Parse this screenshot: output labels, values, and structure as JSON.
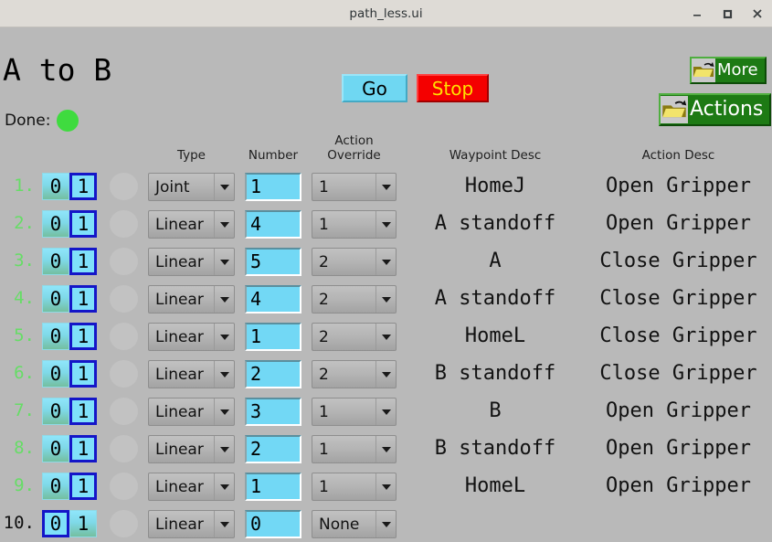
{
  "window": {
    "title": "path_less.ui",
    "controls": [
      {
        "name": "minimize-button",
        "glyph": "minimize"
      },
      {
        "name": "maximize-button",
        "glyph": "maximize"
      },
      {
        "name": "close-button",
        "glyph": "close"
      }
    ]
  },
  "header": {
    "app_title": "A to B",
    "done_label": "Done:",
    "done_color": "#3fdb3f",
    "go_label": "Go",
    "stop_label": "Stop",
    "more_label": "More",
    "actions_label": "Actions",
    "go_color": "#6fd7f2",
    "stop_color": "#f40000",
    "stop_text_color": "#ffe000",
    "folder_button_color": "#1d7a14"
  },
  "columns": {
    "type": "Type",
    "number": "Number",
    "action_override_line1": "Action",
    "action_override_line2": "Override",
    "waypoint_desc": "Waypoint Desc",
    "action_desc": "Action Desc"
  },
  "toggle": {
    "off_label": "0",
    "on_label": "1"
  },
  "rows": [
    {
      "index": "1.",
      "index_color": "green",
      "toggle_selected": "1",
      "type": "Joint",
      "number": "1",
      "override": "1",
      "waypoint": "HomeJ",
      "action": "Open Gripper"
    },
    {
      "index": "2.",
      "index_color": "green",
      "toggle_selected": "1",
      "type": "Linear",
      "number": "4",
      "override": "1",
      "waypoint": "A standoff",
      "action": "Open Gripper"
    },
    {
      "index": "3.",
      "index_color": "green",
      "toggle_selected": "1",
      "type": "Linear",
      "number": "5",
      "override": "2",
      "waypoint": "A",
      "action": "Close Gripper"
    },
    {
      "index": "4.",
      "index_color": "green",
      "toggle_selected": "1",
      "type": "Linear",
      "number": "4",
      "override": "2",
      "waypoint": "A standoff",
      "action": "Close Gripper"
    },
    {
      "index": "5.",
      "index_color": "green",
      "toggle_selected": "1",
      "type": "Linear",
      "number": "1",
      "override": "2",
      "waypoint": "HomeL",
      "action": "Close Gripper"
    },
    {
      "index": "6.",
      "index_color": "green",
      "toggle_selected": "1",
      "type": "Linear",
      "number": "2",
      "override": "2",
      "waypoint": "B standoff",
      "action": "Close Gripper"
    },
    {
      "index": "7.",
      "index_color": "green",
      "toggle_selected": "1",
      "type": "Linear",
      "number": "3",
      "override": "1",
      "waypoint": "B",
      "action": "Open Gripper"
    },
    {
      "index": "8.",
      "index_color": "green",
      "toggle_selected": "1",
      "type": "Linear",
      "number": "2",
      "override": "1",
      "waypoint": "B standoff",
      "action": "Open Gripper"
    },
    {
      "index": "9.",
      "index_color": "green",
      "toggle_selected": "1",
      "type": "Linear",
      "number": "1",
      "override": "1",
      "waypoint": "HomeL",
      "action": "Open Gripper"
    },
    {
      "index": "10.",
      "index_color": "black",
      "toggle_selected": "0",
      "type": "Linear",
      "number": "0",
      "override": "None",
      "waypoint": "",
      "action": ""
    }
  ]
}
